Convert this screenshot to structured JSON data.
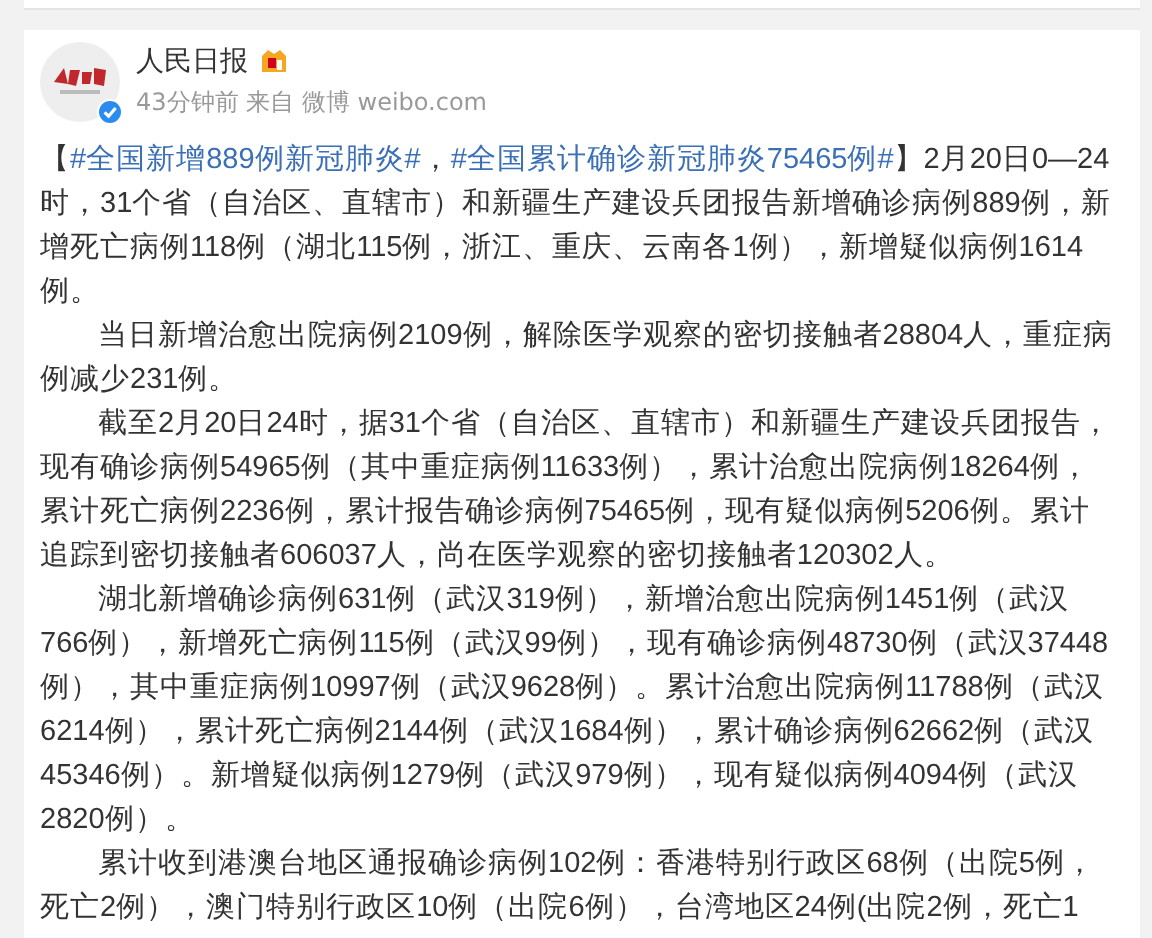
{
  "post": {
    "author": "人民日报",
    "meta": {
      "time": "43分钟前",
      "source_prefix": "来自",
      "source": "微博 weibo.com"
    },
    "paragraphs": [
      {
        "indent": false,
        "parts": [
          {
            "kind": "text",
            "text": "【"
          },
          {
            "kind": "hashtag",
            "text": "#全国新增889例新冠肺炎#"
          },
          {
            "kind": "text",
            "text": "，"
          },
          {
            "kind": "hashtag",
            "text": "#全国累计确诊新冠肺炎75465例#"
          },
          {
            "kind": "text",
            "text": "】2月20日0—24时，31个省（自治区、直辖市）和新疆生产建设兵团报告新增确诊病例889例，新增死亡病例118例（湖北115例，浙江、重庆、云南各1例），新增疑似病例1614例。"
          }
        ]
      },
      {
        "indent": true,
        "parts": [
          {
            "kind": "text",
            "text": "当日新增治愈出院病例2109例，解除医学观察的密切接触者28804人，重症病例减少231例。"
          }
        ]
      },
      {
        "indent": true,
        "parts": [
          {
            "kind": "text",
            "text": "截至2月20日24时，据31个省（自治区、直辖市）和新疆生产建设兵团报告，现有确诊病例54965例（其中重症病例11633例），累计治愈出院病例18264例，累计死亡病例2236例，累计报告确诊病例75465例，现有疑似病例5206例。累计追踪到密切接触者606037人，尚在医学观察的密切接触者120302人。"
          }
        ]
      },
      {
        "indent": true,
        "parts": [
          {
            "kind": "text",
            "text": "湖北新增确诊病例631例（武汉319例），新增治愈出院病例1451例（武汉766例），新增死亡病例115例（武汉99例），现有确诊病例48730例（武汉37448例），其中重症病例10997例（武汉9628例）。累计治愈出院病例11788例（武汉6214例），累计死亡病例2144例（武汉1684例），累计确诊病例62662例（武汉45346例）。新增疑似病例1279例（武汉979例），现有疑似病例4094例（武汉2820例）。"
          }
        ]
      },
      {
        "indent": true,
        "parts": [
          {
            "kind": "text",
            "text": "累计收到港澳台地区通报确诊病例102例：香港特别行政区68例（出院5例，死亡2例），澳门特别行政区10例（出院6例），台湾地区24例(出院2例，死亡1"
          }
        ]
      }
    ]
  }
}
